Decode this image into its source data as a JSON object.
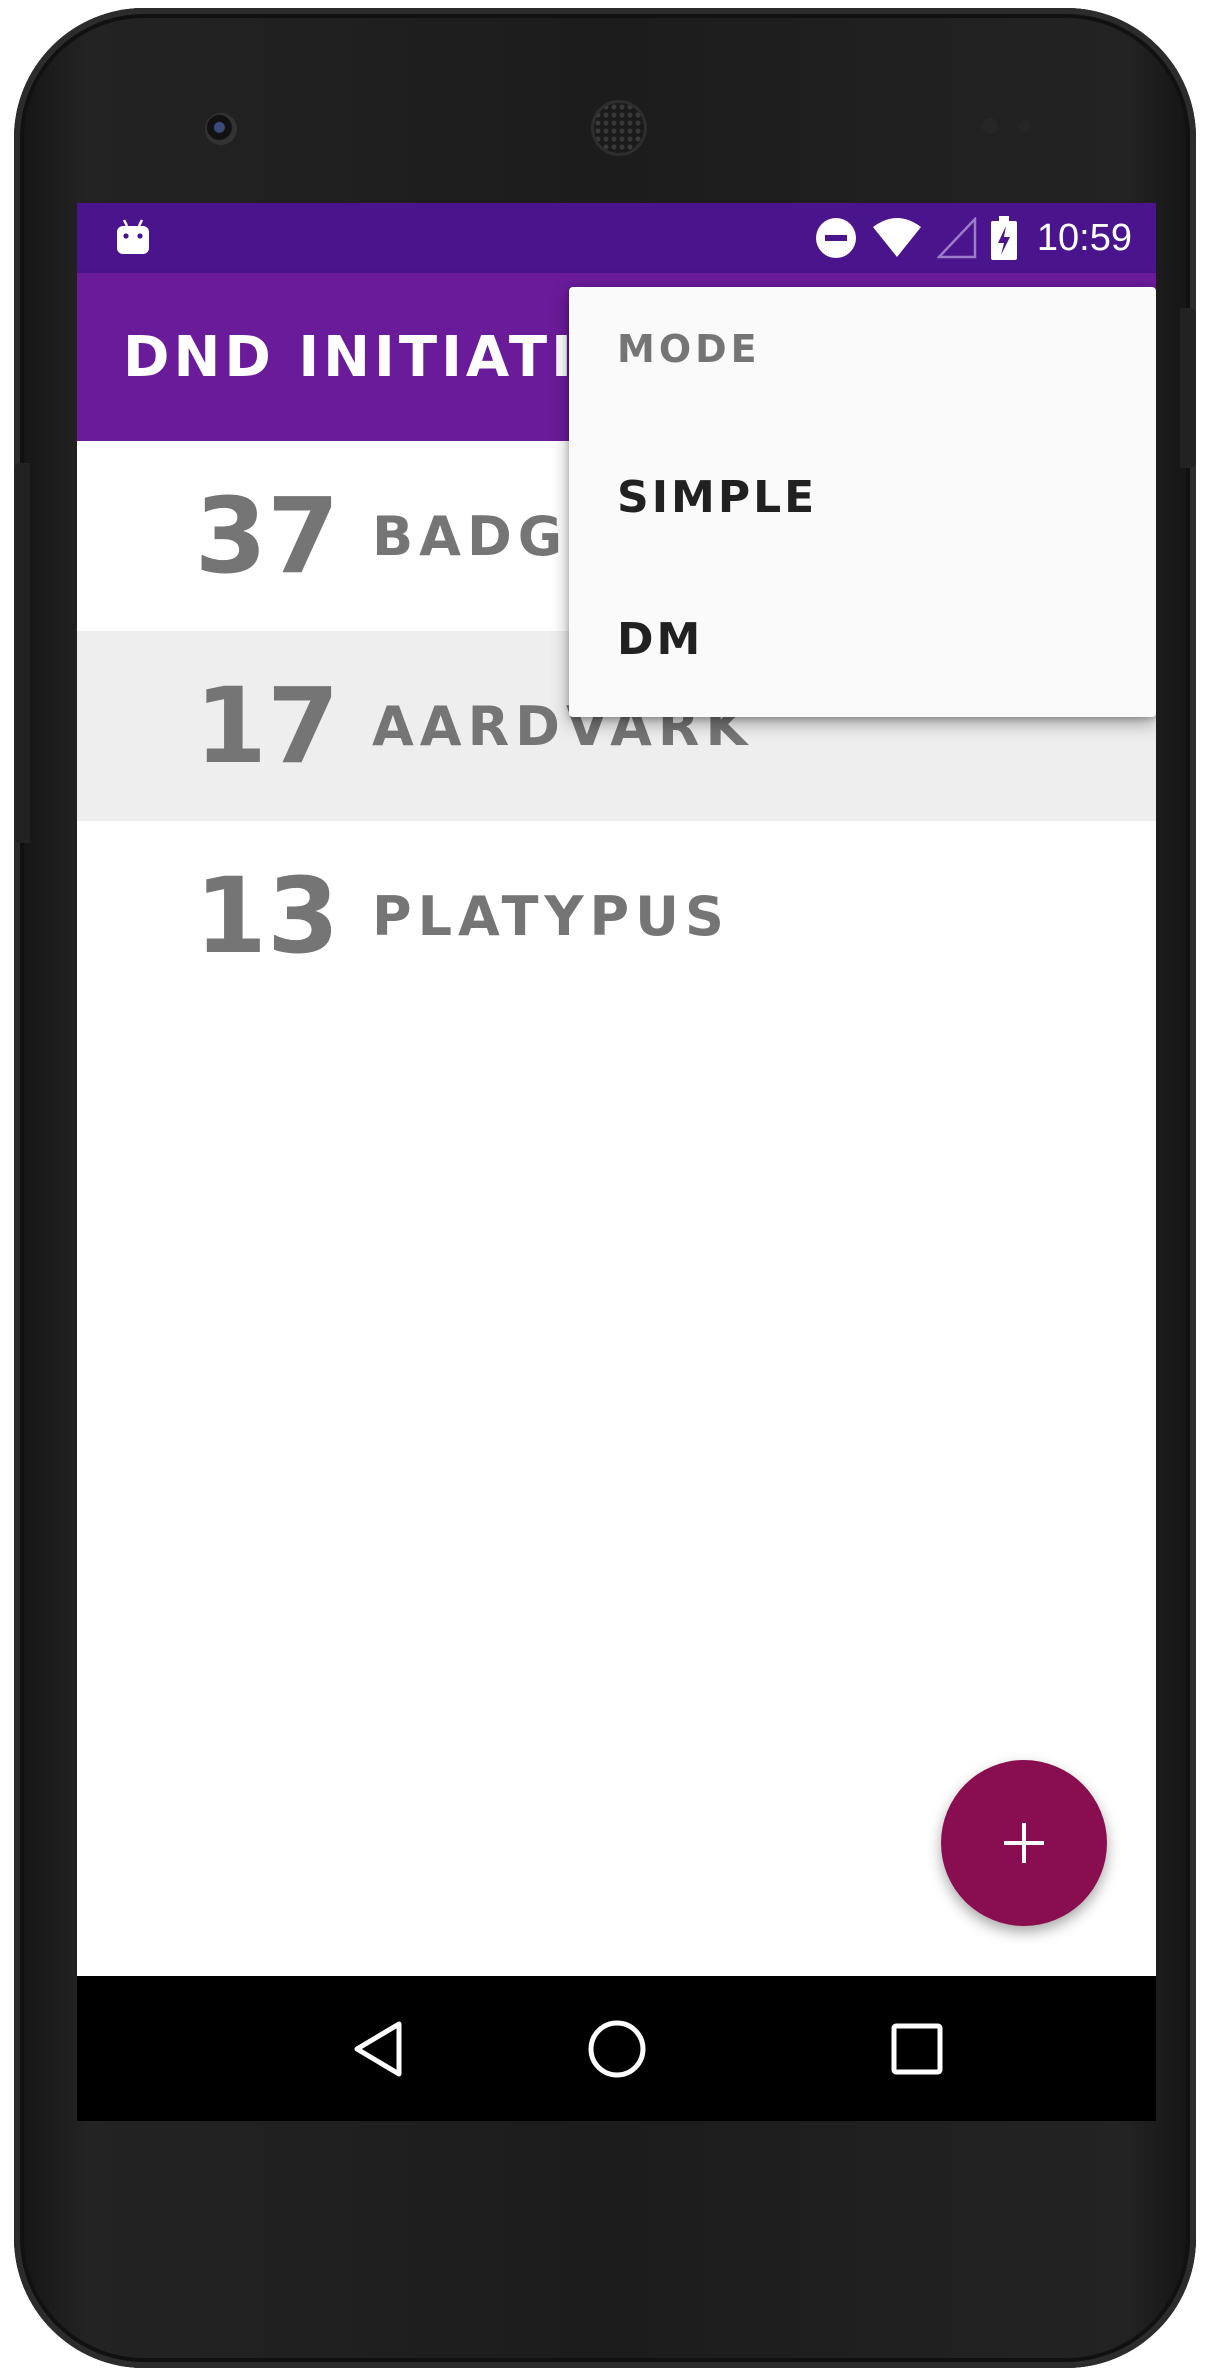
{
  "status_bar": {
    "time": "10:59",
    "icons": [
      "android-debug-icon",
      "do-not-disturb-icon",
      "wifi-icon",
      "cell-signal-icon",
      "battery-charging-icon"
    ],
    "background_color": "#4a148c"
  },
  "app_bar": {
    "title": "DND INITIATIVE",
    "background_color": "#6a1b9a"
  },
  "list": {
    "items": [
      {
        "initiative": "37",
        "name": "BADGER",
        "selected": false
      },
      {
        "initiative": "17",
        "name": "AARDVARK",
        "selected": true
      },
      {
        "initiative": "13",
        "name": "PLATYPUS",
        "selected": false
      }
    ]
  },
  "menu": {
    "header": "MODE",
    "items": [
      {
        "label": "SIMPLE"
      },
      {
        "label": "DM"
      }
    ]
  },
  "fab": {
    "icon": "plus-icon",
    "color": "#880e4f"
  },
  "nav_bar": {
    "icons": [
      "back-icon",
      "home-icon",
      "recents-icon"
    ]
  }
}
